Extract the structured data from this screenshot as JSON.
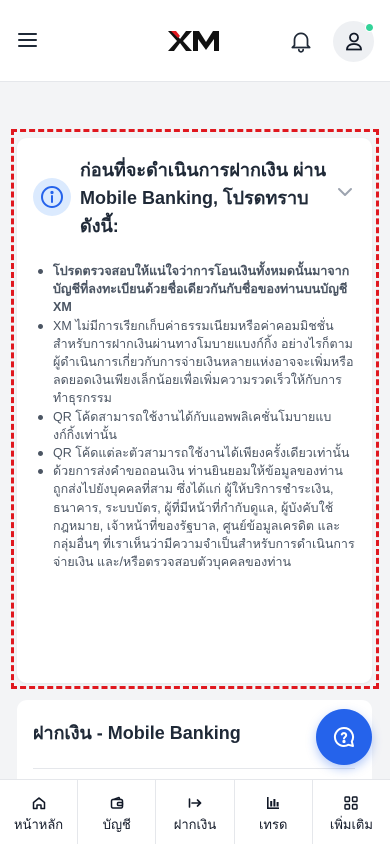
{
  "header": {
    "logo_text": "XM",
    "brand_color": "#111111",
    "accent_color": "#e0181f",
    "icons": [
      "menu-icon",
      "bell-icon",
      "user-icon"
    ]
  },
  "notice": {
    "title": "ก่อนที่จะดำเนินการฝากเงิน ผ่าน Mobile Banking, โปรดทราบดังนี้:",
    "icon": "info-icon",
    "outline_color": "#e0181f",
    "items": [
      "โปรดตรวจสอบให้แน่ใจว่าการโอนเงินทั้งหมดนั้นมาจากบัญชีที่ลงทะเบียนด้วยชื่อเดียวกันกับชื่อของท่านบนบัญชี XM",
      "XM ไม่มีการเรียกเก็บค่าธรรมเนียมหรือค่าคอมมิชชั่นสำหรับการฝากเงินผ่านทางโมบายแบงก์กิ้ง อย่างไรก็ตามผู้ดำเนินการเกี่ยวกับการจ่ายเงินหลายแห่งอาจจะเพิ่มหรือลดยอดเงินเพียงเล็กน้อยเพื่อเพิ่มความรวดเร็วให้กับการทำธุรกรรม",
      "QR โค้ดสามารถใช้งานได้กับแอพพลิเคชั่นโมบายแบงก์กิ้งเท่านั้น",
      "QR โค้ดแต่ละตัวสามารถใช้งานได้เพียงครั้งเดียวเท่านั้น",
      "ด้วยการส่งคำขอถอนเงิน ท่านยินยอมให้ข้อมูลของท่านถูกส่งไปยังบุคคลที่สาม ซึ่งได้แก่ ผู้ให้บริการชำระเงิน, ธนาคาร, ระบบบัตร, ผู้ที่มีหน้าที่กำกับดูแล, ผู้บังคับใช้กฎหมาย, เจ้าหน้าที่ของรัฐบาล, ศูนย์ข้อมูลเครดิต และกลุ่มอื่นๆ ที่เราเห็นว่ามีความจำเป็นสำหรับการดำเนินการจ่ายเงิน และ/หรือตรวจสอบตัวบุคคลของท่าน"
    ]
  },
  "deposit_section": {
    "title": "ฝากเงิน - Mobile Banking"
  },
  "chat": {
    "icon": "chat-help-icon",
    "color": "#2563eb"
  },
  "bottom_nav": [
    {
      "label": "หน้าหลัก",
      "icon": "home-icon"
    },
    {
      "label": "บัญชี",
      "icon": "wallet-icon"
    },
    {
      "label": "ฝากเงิน",
      "icon": "deposit-arrow-icon"
    },
    {
      "label": "เทรด",
      "icon": "chart-bars-icon"
    },
    {
      "label": "เพิ่มเติม",
      "icon": "grid-icon"
    }
  ]
}
